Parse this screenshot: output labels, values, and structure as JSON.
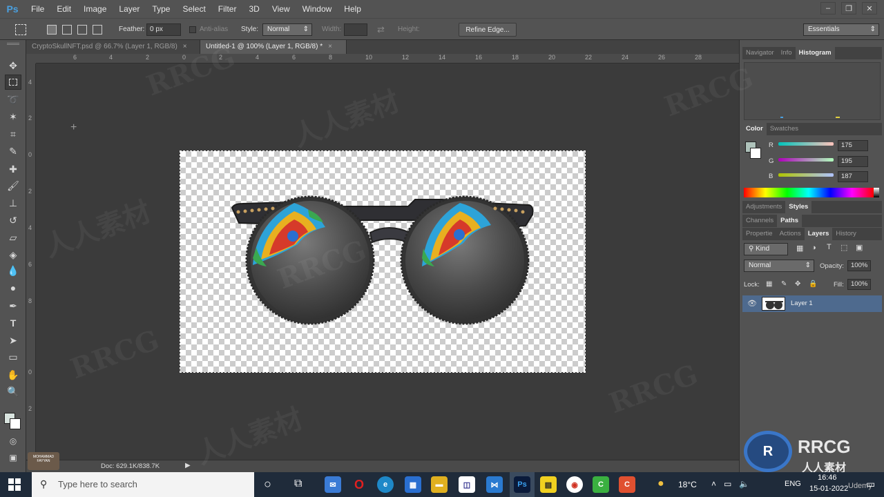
{
  "menubar": {
    "logo": "Ps",
    "items": [
      "File",
      "Edit",
      "Image",
      "Layer",
      "Type",
      "Select",
      "Filter",
      "3D",
      "View",
      "Window",
      "Help"
    ]
  },
  "options": {
    "feather_label": "Feather:",
    "feather_value": "0 px",
    "antialias_label": "Anti-alias",
    "style_label": "Style:",
    "style_value": "Normal",
    "width_label": "Width:",
    "height_label": "Height:",
    "refine_edge": "Refine Edge...",
    "workspace": "Essentials"
  },
  "tabs": [
    {
      "label": "CryptoSkullNFT.psd @ 66.7% (Layer 1, RGB/8)",
      "close": "×"
    },
    {
      "label": "Untitled-1 @ 100% (Layer 1, RGB/8) *",
      "close": "×"
    }
  ],
  "ruler_top": [
    "6",
    "4",
    "2",
    "0",
    "2",
    "4",
    "6",
    "8",
    "10",
    "12",
    "14",
    "16",
    "18",
    "20",
    "22",
    "24",
    "26",
    "28"
  ],
  "ruler_left": [
    "4",
    "2",
    "0",
    "2",
    "4",
    "6",
    "8",
    "0",
    "2"
  ],
  "status": {
    "doc": "Doc: 629.1K/838.7K"
  },
  "panels": {
    "top_tabs": [
      "Navigator",
      "Info",
      "Histogram"
    ],
    "color_tabs": [
      "Color",
      "Swatches"
    ],
    "color": {
      "r_label": "R",
      "r_value": "175",
      "g_label": "G",
      "g_value": "195",
      "b_label": "B",
      "b_value": "187",
      "foreground": "#afc3bb"
    },
    "adj_tabs": [
      "Adjustments",
      "Styles"
    ],
    "channel_tabs": [
      "Channels",
      "Paths"
    ],
    "layer_tabs": [
      "Propertie",
      "Actions",
      "Layers",
      "History"
    ],
    "kind_label": "Kind",
    "blend_mode": "Normal",
    "opacity_label": "Opacity:",
    "opacity_value": "100%",
    "lock_label": "Lock:",
    "fill_label": "Fill:",
    "fill_value": "100%",
    "layer_name": "Layer 1"
  },
  "taskbar": {
    "search_placeholder": "Type here to search",
    "temperature": "18°C",
    "language": "ENG",
    "time": "16:46",
    "date": "15-01-2022"
  },
  "watermarks": [
    "RRCG",
    "人人素材",
    "RRCG",
    "人人素材",
    "RRCG",
    "RRCG",
    "人人素材",
    "RRCG"
  ],
  "brand": {
    "name": "RRCG",
    "sub": "人人素材",
    "udemy": "Udemy",
    "mini_logo": "MOHAMMAD\nFAYYAN"
  },
  "colors": {
    "accent": "#4aa0e0",
    "panel": "#535353",
    "workspace": "#3b3b3b",
    "selected_layer": "#4e6a8e"
  }
}
